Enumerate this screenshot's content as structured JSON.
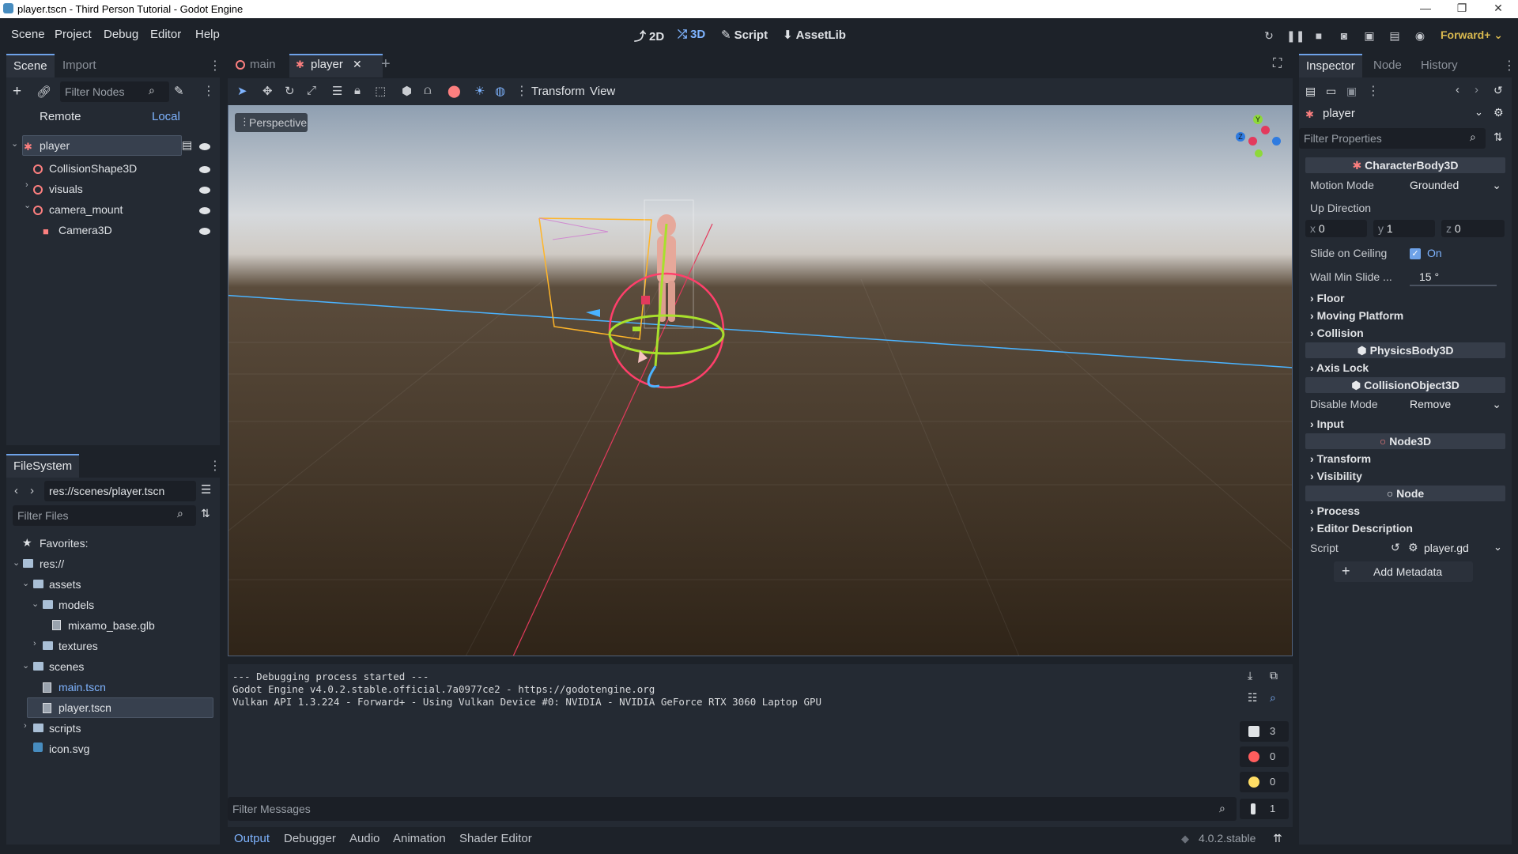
{
  "window": {
    "title": "player.tscn - Third Person Tutorial - Godot Engine",
    "minimize": "—",
    "maximize": "❐",
    "close": "✕"
  },
  "menu": [
    "Scene",
    "Project",
    "Debug",
    "Editor",
    "Help"
  ],
  "modes": [
    {
      "label": "2D",
      "icon": "2d-icon"
    },
    {
      "label": "3D",
      "icon": "3d-icon"
    },
    {
      "label": "Script",
      "icon": "script-icon"
    },
    {
      "label": "AssetLib",
      "icon": "assetlib-icon"
    }
  ],
  "renderer": "Forward+",
  "scene_dock": {
    "tabs": [
      "Scene",
      "Import"
    ],
    "filter_placeholder": "Filter Nodes",
    "remote": "Remote",
    "local": "Local",
    "nodes": [
      {
        "name": "player",
        "depth": 0
      },
      {
        "name": "CollisionShape3D",
        "depth": 1
      },
      {
        "name": "visuals",
        "depth": 1
      },
      {
        "name": "camera_mount",
        "depth": 1
      },
      {
        "name": "Camera3D",
        "depth": 2
      }
    ]
  },
  "filesystem": {
    "title": "FileSystem",
    "path": "res://scenes/player.tscn",
    "filter_placeholder": "Filter Files",
    "favorites": "Favorites:",
    "items": [
      {
        "name": "res://",
        "depth": 0,
        "kind": "folder"
      },
      {
        "name": "assets",
        "depth": 1,
        "kind": "folder"
      },
      {
        "name": "models",
        "depth": 2,
        "kind": "folder"
      },
      {
        "name": "mixamo_base.glb",
        "depth": 3,
        "kind": "file"
      },
      {
        "name": "textures",
        "depth": 2,
        "kind": "folder"
      },
      {
        "name": "scenes",
        "depth": 1,
        "kind": "folder"
      },
      {
        "name": "main.tscn",
        "depth": 2,
        "kind": "file"
      },
      {
        "name": "player.tscn",
        "depth": 2,
        "kind": "file"
      },
      {
        "name": "scripts",
        "depth": 1,
        "kind": "folder"
      },
      {
        "name": "icon.svg",
        "depth": 1,
        "kind": "file"
      }
    ]
  },
  "scene_tabs": {
    "main": "main",
    "player": "player",
    "close": "✕",
    "add": "+"
  },
  "viewport_toolbar": {
    "transform": "Transform",
    "view": "View",
    "perspective": "Perspective"
  },
  "gizmo_axes": {
    "y": "Y",
    "z": "Z"
  },
  "output": {
    "lines": [
      "--- Debugging process started ---",
      "Godot Engine v4.0.2.stable.official.7a0977ce2 - https://godotengine.org",
      "Vulkan API 1.3.224 - Forward+ - Using Vulkan Device #0: NVIDIA - NVIDIA GeForce RTX 3060 Laptop GPU"
    ],
    "filter_placeholder": "Filter Messages",
    "counts": {
      "messages": "3",
      "errors": "0",
      "warnings": "0",
      "info": "1"
    }
  },
  "bottom_tabs": [
    "Output",
    "Debugger",
    "Audio",
    "Animation",
    "Shader Editor"
  ],
  "version": "4.0.2.stable",
  "inspector": {
    "tabs": [
      "Inspector",
      "Node",
      "History"
    ],
    "object": "player",
    "filter_placeholder": "Filter Properties",
    "class_character": "CharacterBody3D",
    "motion_mode_label": "Motion Mode",
    "motion_mode_value": "Grounded",
    "up_direction": "Up Direction",
    "up_x_label": "x",
    "up_x": "0",
    "up_y_label": "y",
    "up_y": "1",
    "up_z_label": "z",
    "up_z": "0",
    "slide_ceiling_label": "Slide on Ceiling",
    "slide_ceiling_value": "On",
    "wall_min_label": "Wall Min Slide ...",
    "wall_min_value": "15 °",
    "sections1": [
      "Floor",
      "Moving Platform",
      "Collision"
    ],
    "class_physics": "PhysicsBody3D",
    "axis_lock": "Axis Lock",
    "class_collision": "CollisionObject3D",
    "disable_mode_label": "Disable Mode",
    "disable_mode_value": "Remove",
    "input": "Input",
    "class_node3d": "Node3D",
    "sections2": [
      "Transform",
      "Visibility"
    ],
    "class_node": "Node",
    "sections3": [
      "Process",
      "Editor Description"
    ],
    "script_label": "Script",
    "script_value": "player.gd",
    "add_metadata": "Add Metadata"
  }
}
